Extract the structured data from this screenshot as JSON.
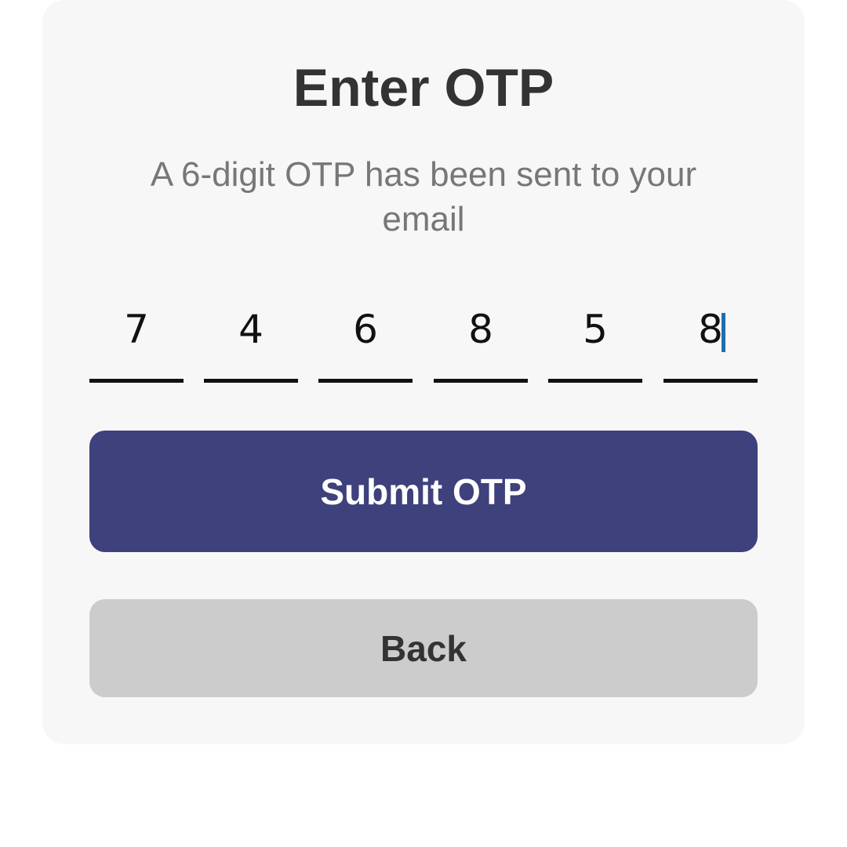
{
  "title": "Enter OTP",
  "subtitle": "A 6-digit OTP has been sent to your email",
  "otp": {
    "digits": [
      "7",
      "4",
      "6",
      "8",
      "5",
      "8"
    ],
    "focused_index": 5
  },
  "buttons": {
    "submit_label": "Submit OTP",
    "back_label": "Back"
  },
  "colors": {
    "primary": "#3f417c",
    "secondary": "#cccccc",
    "card_background": "#f7f7f7",
    "caret": "#1f6fb0"
  }
}
